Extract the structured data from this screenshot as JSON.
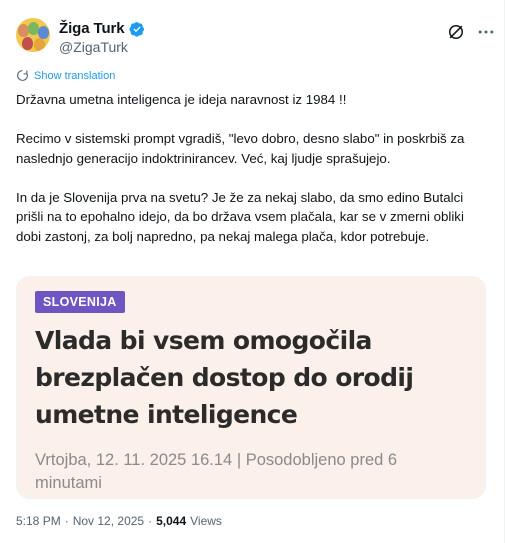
{
  "author": {
    "display_name": "Žiga Turk",
    "handle": "@ZigaTurk"
  },
  "translate": {
    "label": "Show translation"
  },
  "tweet": {
    "paragraphs": [
      "Državna umetna inteligenca je ideja naravnost iz 1984 !!",
      "Recimo v sistemski prompt vgradiš, \"levo dobro, desno slabo\" in poskrbiš za naslednjo generacijo indoktrinirancev. Već, kaj ljudje sprašujejo.",
      "In da je Slovenija prva na svetu? Je že za nekaj slabo, da smo edino Butalci prišli na to epohalno idejo, da bo država vsem plačala, kar se v zmerni obliki dobi zastonj, za bolj napredno, pa nekaj malega plača, kdor potrebuje."
    ]
  },
  "card": {
    "badge": "SLOVENIJA",
    "headline": "Vlada bi vsem omogočila brezplačen dostop do orodij umetne inteligence",
    "meta": "Vrtojba, 12. 11. 2025 16.14 | Posodobljeno pred 6 minutami"
  },
  "footer": {
    "time": "5:18 PM",
    "separator1": "·",
    "date": "Nov 12, 2025",
    "separator2": "·",
    "views_count": "5,044",
    "views_label": "Views"
  },
  "colors": {
    "accent": "#1d9bf0",
    "badge_bg": "#6e55c2",
    "card_bg": "#fbf0ea"
  }
}
